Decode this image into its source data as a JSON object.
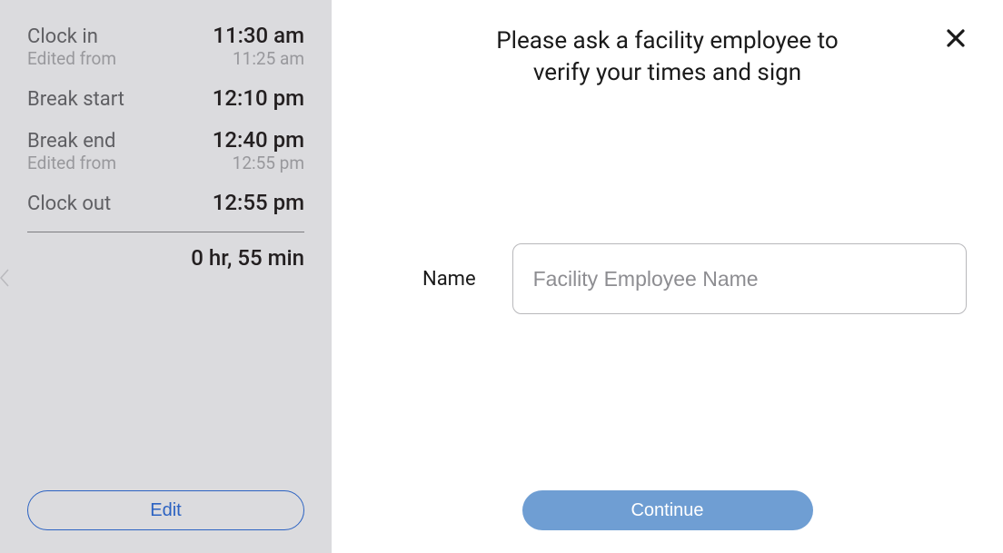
{
  "sidebar": {
    "rows": [
      {
        "label": "Clock in",
        "value": "11:30 am",
        "edited_label": "Edited from",
        "edited_value": "11:25 am"
      },
      {
        "label": "Break start",
        "value": "12:10 pm"
      },
      {
        "label": "Break end",
        "value": "12:40 pm",
        "edited_label": "Edited from",
        "edited_value": "12:55 pm"
      },
      {
        "label": "Clock out",
        "value": "12:55 pm"
      }
    ],
    "total": "0 hr, 55 min",
    "edit_label": "Edit"
  },
  "main": {
    "title_line1": "Please ask a facility employee to",
    "title_line2": "verify your times and sign",
    "name_label": "Name",
    "name_placeholder": "Facility Employee Name",
    "continue_label": "Continue"
  }
}
